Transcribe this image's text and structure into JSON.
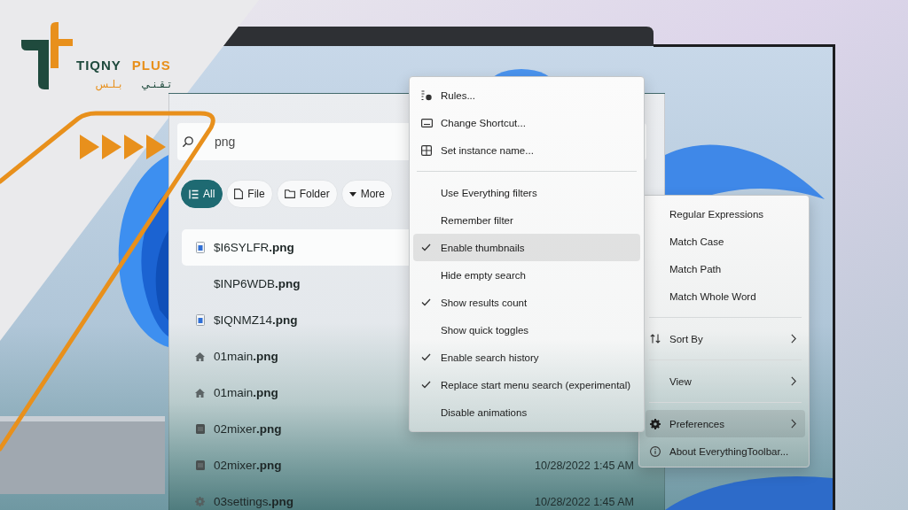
{
  "logo": {
    "wordmark": "TIQNY",
    "wordmark_accent": "PLUS",
    "arabic": "تـقـنـي",
    "arabic_accent": "بـلـس"
  },
  "search": {
    "value": "png"
  },
  "filters": [
    {
      "label": "All",
      "selected": true
    },
    {
      "label": "File",
      "selected": false
    },
    {
      "label": "Folder",
      "selected": false
    },
    {
      "label": "More",
      "selected": false
    }
  ],
  "results": [
    {
      "name": "$I6SYLFR**.png**",
      "kind": "document",
      "selected": true
    },
    {
      "name": "$INP6WDB**.png**",
      "kind": "blank",
      "selected": false
    },
    {
      "name": "$IQNMZ14**.png**",
      "kind": "document",
      "selected": false
    },
    {
      "name": "01main**.png**",
      "kind": "home",
      "selected": false
    },
    {
      "name": "01main**.png**",
      "kind": "home",
      "selected": false
    },
    {
      "name": "02mixer**.png**",
      "kind": "panel",
      "selected": false
    },
    {
      "name": "02mixer**.png**",
      "kind": "panel",
      "selected": false,
      "date": "10/28/2022 1:45 AM"
    },
    {
      "name": "03settings**.png**",
      "kind": "gear",
      "selected": false,
      "date": "10/28/2022 1:45 AM"
    }
  ],
  "menu": {
    "sections": [
      [
        {
          "label": "Rules...",
          "kind": "command",
          "selected": false
        },
        {
          "label": "Change Shortcut...",
          "kind": "command",
          "selected": false
        },
        {
          "label": "Set instance name...",
          "kind": "command",
          "selected": false
        }
      ],
      [
        {
          "label": "Use Everything filters",
          "kind": "toggle",
          "checked": false,
          "selected": false
        },
        {
          "label": "Remember filter",
          "kind": "toggle",
          "checked": false,
          "selected": false
        },
        {
          "label": "Enable thumbnails",
          "kind": "toggle",
          "checked": true,
          "selected": true
        },
        {
          "label": "Hide empty search",
          "kind": "toggle",
          "checked": false,
          "selected": false
        },
        {
          "label": "Show results count",
          "kind": "toggle",
          "checked": true,
          "selected": false
        },
        {
          "label": "Show quick toggles",
          "kind": "toggle",
          "checked": false,
          "selected": false
        },
        {
          "label": "Enable search history",
          "kind": "toggle",
          "checked": true,
          "selected": false
        },
        {
          "label": "Replace start menu search (experimental)",
          "kind": "toggle",
          "checked": true,
          "selected": false
        },
        {
          "label": "Disable animations",
          "kind": "toggle",
          "checked": false,
          "selected": false
        }
      ]
    ]
  },
  "submenu": {
    "sections": [
      [
        {
          "label": "Regular Expressions",
          "kind": "toggle",
          "checked": false,
          "selected": false
        },
        {
          "label": "Match Case",
          "kind": "toggle",
          "checked": false,
          "selected": false
        },
        {
          "label": "Match Path",
          "kind": "toggle",
          "checked": false,
          "selected": false
        },
        {
          "label": "Match Whole Word",
          "kind": "toggle",
          "checked": false,
          "selected": false
        }
      ],
      [
        {
          "label": "Sort By",
          "kind": "submenu",
          "selected": false
        }
      ],
      [
        {
          "label": "View",
          "kind": "submenu",
          "selected": false
        }
      ],
      [
        {
          "label": "Preferences",
          "kind": "submenu",
          "selected": true
        },
        {
          "label": "About EverythingToolbar...",
          "kind": "command",
          "selected": false
        }
      ]
    ]
  }
}
